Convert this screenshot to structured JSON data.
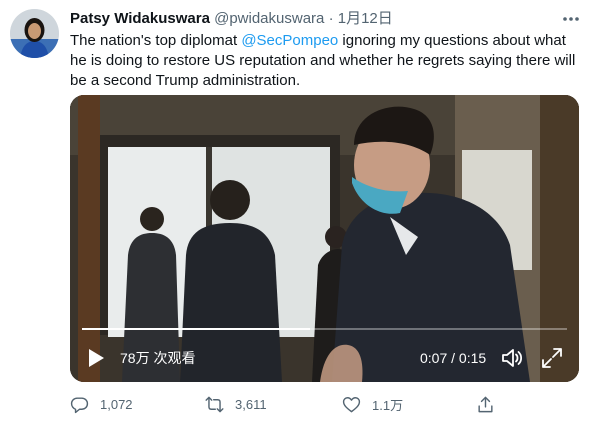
{
  "tweet": {
    "author_name": "Patsy Widakuswara",
    "handle": "@pwidakuswara",
    "separator": "·",
    "timestamp": "1月12日",
    "text_before": "The nation's top diplomat ",
    "mention": "@SecPompeo",
    "text_after": " ignoring my questions about what he is doing to restore US reputation and whether he regrets saying there will be a second Trump administration."
  },
  "video": {
    "views": "78万 次观看",
    "time": "0:07 / 0:15",
    "progress": 0.47
  },
  "actions": {
    "replies": "1,072",
    "retweets": "3,611",
    "likes": "1.1万"
  },
  "icons": {
    "more": "more-icon",
    "play": "play-icon",
    "volume": "volume-icon",
    "fullscreen": "fullscreen-icon",
    "reply": "reply-icon",
    "retweet": "retweet-icon",
    "like": "heart-icon",
    "share": "share-icon"
  },
  "colors": {
    "accent": "#1d9bf0",
    "secondary_text": "#536471"
  }
}
